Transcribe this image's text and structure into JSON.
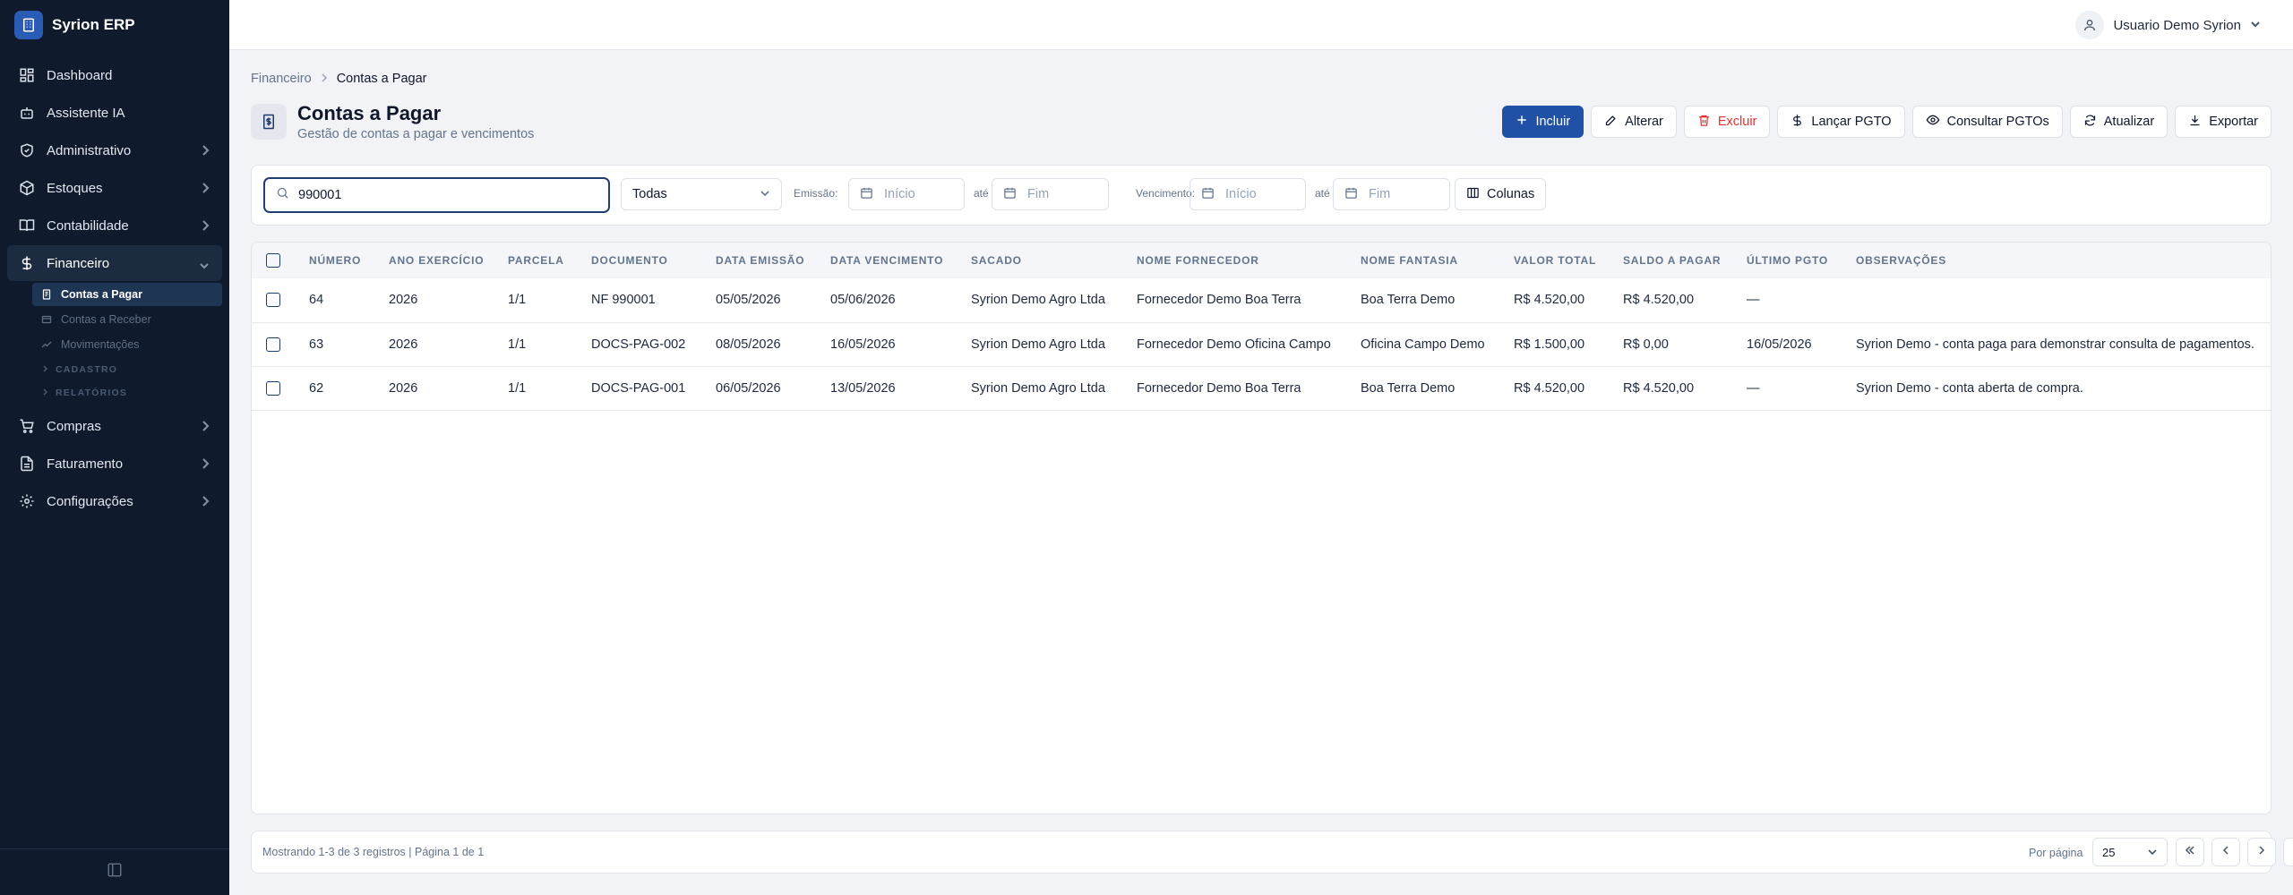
{
  "app": {
    "name": "Syrion ERP"
  },
  "sidebar": {
    "items": [
      {
        "label": "Dashboard",
        "icon": "dashboard-icon"
      },
      {
        "label": "Assistente IA",
        "icon": "bot-icon"
      },
      {
        "label": "Administrativo",
        "icon": "shield-icon"
      },
      {
        "label": "Estoques",
        "icon": "box-icon"
      },
      {
        "label": "Contabilidade",
        "icon": "book-icon"
      },
      {
        "label": "Financeiro",
        "icon": "dollar-icon"
      },
      {
        "label": "Compras",
        "icon": "cart-icon"
      },
      {
        "label": "Faturamento",
        "icon": "file-icon"
      },
      {
        "label": "Configurações",
        "icon": "gear-icon"
      }
    ],
    "financeiro_sub": {
      "items": [
        {
          "label": "Contas a Pagar"
        },
        {
          "label": "Contas a Receber"
        },
        {
          "label": "Movimentações"
        }
      ],
      "sections": [
        "CADASTRO",
        "RELATÓRIOS"
      ]
    }
  },
  "header": {
    "user_name": "Usuario Demo Syrion"
  },
  "breadcrumb": {
    "parent": "Financeiro",
    "current": "Contas a Pagar"
  },
  "page": {
    "title": "Contas a Pagar",
    "subtitle": "Gestão de contas a pagar e vencimentos"
  },
  "actions": {
    "incluir": "Incluir",
    "alterar": "Alterar",
    "excluir": "Excluir",
    "lancar": "Lançar PGTO",
    "consultar": "Consultar PGTOs",
    "atualizar": "Atualizar",
    "exportar": "Exportar"
  },
  "filters": {
    "search_value": "990001",
    "status": "Todas",
    "emissao_label": "Emissão:",
    "vencimento_label": "Vencimento:",
    "ate": "até",
    "inicio_placeholder": "Início",
    "fim_placeholder": "Fim",
    "colunas": "Colunas"
  },
  "table": {
    "columns": [
      "Número",
      "Ano Exercício",
      "Parcela",
      "Documento",
      "Data Emissão",
      "Data Vencimento",
      "Sacado",
      "Nome Fornecedor",
      "Nome Fantasia",
      "Valor Total",
      "Saldo a Pagar",
      "Último PGTO",
      "Observações"
    ],
    "rows": [
      [
        "64",
        "2026",
        "1/1",
        "NF 990001",
        "05/05/2026",
        "05/06/2026",
        "Syrion Demo Agro Ltda",
        "Fornecedor Demo Boa Terra",
        "Boa Terra Demo",
        "R$ 4.520,00",
        "R$ 4.520,00",
        "—",
        ""
      ],
      [
        "63",
        "2026",
        "1/1",
        "DOCS-PAG-002",
        "08/05/2026",
        "16/05/2026",
        "Syrion Demo Agro Ltda",
        "Fornecedor Demo Oficina Campo",
        "Oficina Campo Demo",
        "R$ 1.500,00",
        "R$ 0,00",
        "16/05/2026",
        "Syrion Demo - conta paga para demonstrar consulta de pagamentos."
      ],
      [
        "62",
        "2026",
        "1/1",
        "DOCS-PAG-001",
        "06/05/2026",
        "13/05/2026",
        "Syrion Demo Agro Ltda",
        "Fornecedor Demo Boa Terra",
        "Boa Terra Demo",
        "R$ 4.520,00",
        "R$ 4.520,00",
        "—",
        "Syrion Demo - conta aberta de compra."
      ]
    ]
  },
  "pagination": {
    "info": "Mostrando 1-3 de 3 registros | Página 1 de 1",
    "per_page_label": "Por página",
    "per_page_value": "25"
  }
}
